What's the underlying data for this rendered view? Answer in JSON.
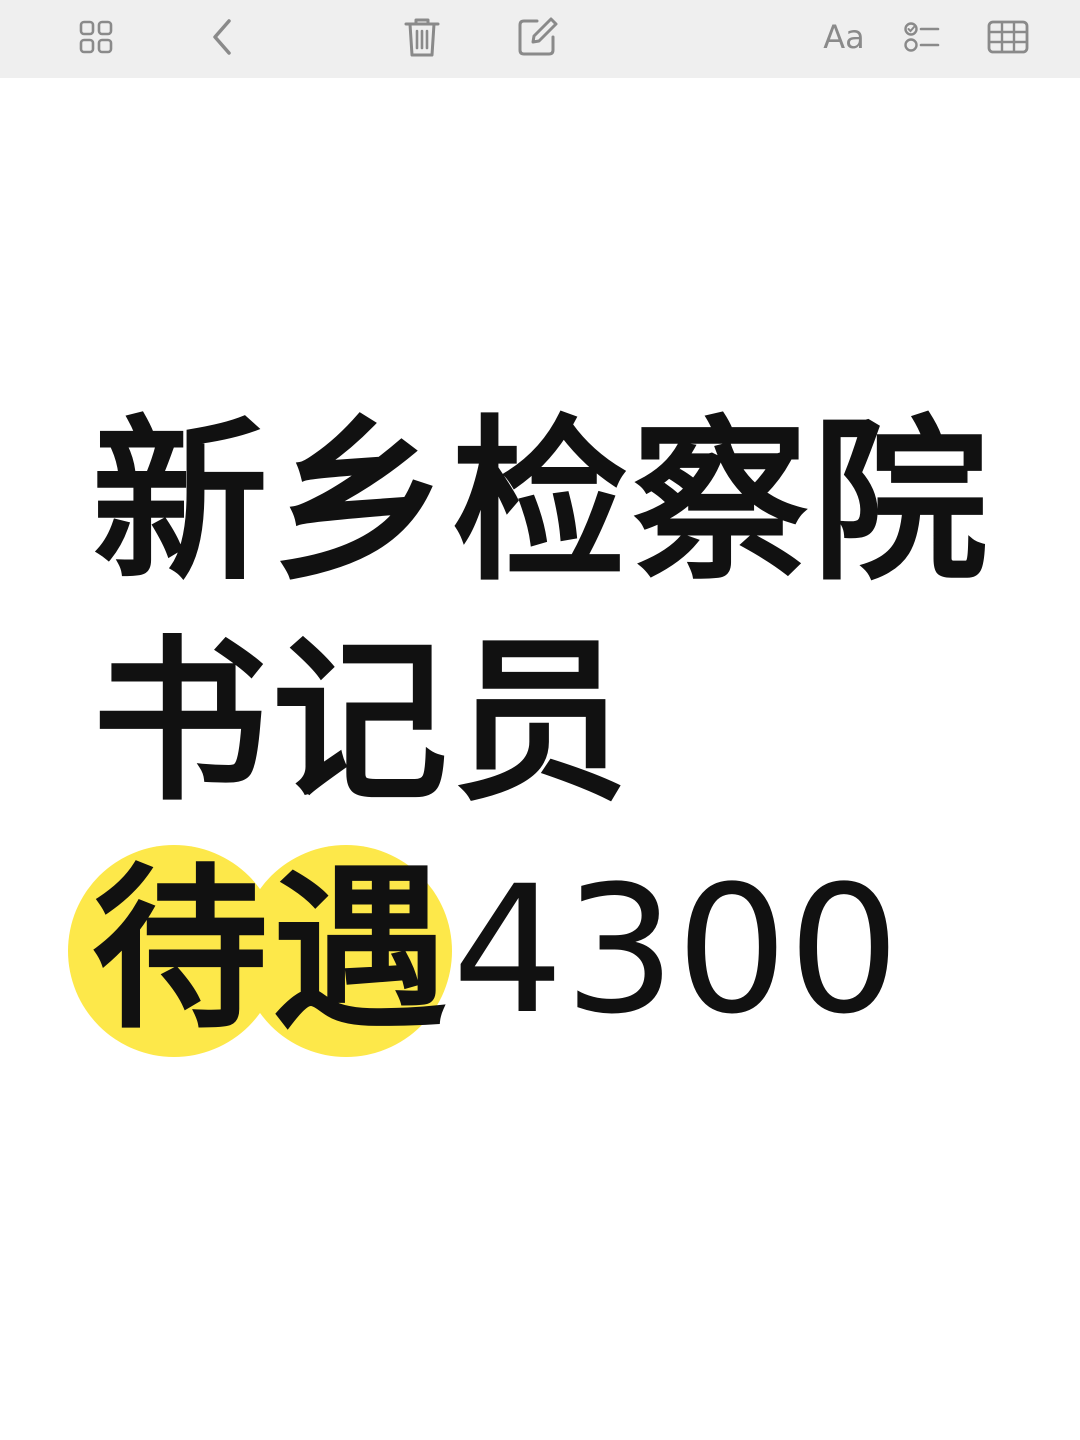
{
  "toolbar": {
    "icons": [
      "grid-icon",
      "back-chevron-icon",
      "trash-icon",
      "compose-icon",
      "checklist-icon",
      "table-icon"
    ],
    "format_label": "Aa"
  },
  "note": {
    "line1": "新乡检察院",
    "line2": "书记员",
    "line3_highlight": "待遇",
    "line3_amount": "4300",
    "highlight_color": "#fde84a",
    "text_color": "#111111"
  }
}
